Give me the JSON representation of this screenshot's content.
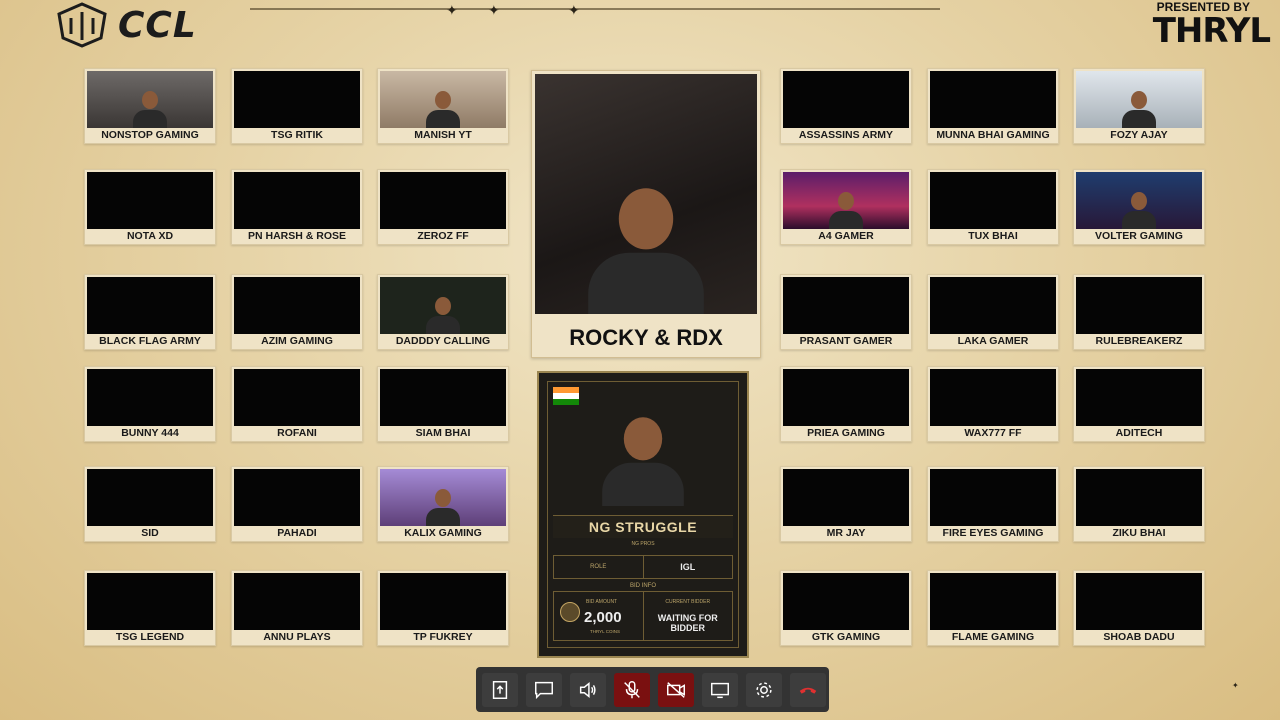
{
  "branding": {
    "logo_text": "CCL",
    "sponsor_label": "PRESENTED BY",
    "sponsor_name": "THRYL"
  },
  "featured": {
    "name": "ROCKY & RDX"
  },
  "participants": [
    {
      "name": "NONSTOP GAMING",
      "feed": "lit"
    },
    {
      "name": "TSG RITIK",
      "feed": "dark"
    },
    {
      "name": "MANISH YT",
      "feed": "room"
    },
    {
      "name": "ASSASSINS ARMY",
      "feed": "dark"
    },
    {
      "name": "MUNNA BHAI GAMING",
      "feed": "dark"
    },
    {
      "name": "FOZY AJAY",
      "feed": "bright"
    },
    {
      "name": "NOTA XD",
      "feed": "dark"
    },
    {
      "name": "PN HARSH & ROSE",
      "feed": "dark"
    },
    {
      "name": "ZEROZ FF",
      "feed": "dark"
    },
    {
      "name": "A4 GAMER",
      "feed": "neon"
    },
    {
      "name": "TUX BHAI",
      "feed": "dark"
    },
    {
      "name": "VOLTER GAMING",
      "feed": "blue"
    },
    {
      "name": "BLACK FLAG ARMY",
      "feed": "dark"
    },
    {
      "name": "AZIM GAMING",
      "feed": "dark"
    },
    {
      "name": "DADDDY CALLING",
      "feed": "green"
    },
    {
      "name": "PRASANT GAMER",
      "feed": "dark"
    },
    {
      "name": "LAKA GAMER",
      "feed": "dark"
    },
    {
      "name": "RULEBREAKERZ",
      "feed": "dark"
    },
    {
      "name": "BUNNY 444",
      "feed": "dark"
    },
    {
      "name": "ROFANI",
      "feed": "dark"
    },
    {
      "name": "SIAM BHAI",
      "feed": "dark"
    },
    {
      "name": "PRIEA GAMING",
      "feed": "dark"
    },
    {
      "name": "WAX777 FF",
      "feed": "dark"
    },
    {
      "name": "ADITECH",
      "feed": "dark"
    },
    {
      "name": "SID",
      "feed": "dark"
    },
    {
      "name": "PAHADI",
      "feed": "dark"
    },
    {
      "name": "KALIX GAMING",
      "feed": "purple"
    },
    {
      "name": "MR JAY",
      "feed": "dark"
    },
    {
      "name": "FIRE EYES GAMING",
      "feed": "dark"
    },
    {
      "name": "ZIKU BHAI",
      "feed": "dark"
    },
    {
      "name": "TSG LEGEND",
      "feed": "dark"
    },
    {
      "name": "ANNU PLAYS",
      "feed": "dark"
    },
    {
      "name": "TP FUKREY",
      "feed": "dark"
    },
    {
      "name": "GTK GAMING",
      "feed": "dark"
    },
    {
      "name": "FLAME GAMING",
      "feed": "dark"
    },
    {
      "name": "SHOAB DADU",
      "feed": "dark"
    }
  ],
  "player_card": {
    "country": "India",
    "name": "NG STRUGGLE",
    "team": "NG PROS",
    "role_label": "ROLE",
    "role_value": "IGL",
    "bid_info_label": "BID INFO",
    "bid_amount_label": "BID AMOUNT",
    "bid_amount": "2,000",
    "currency": "THRYL COINS",
    "current_bidder_label": "CURRENT BIDDER",
    "current_bidder": "WAITING FOR BIDDER"
  },
  "toolbar": {
    "buttons": [
      {
        "name": "share-button",
        "icon": "upload-icon",
        "style": "normal"
      },
      {
        "name": "chat-button",
        "icon": "chat-icon",
        "style": "normal"
      },
      {
        "name": "speaker-button",
        "icon": "speaker-icon",
        "style": "normal"
      },
      {
        "name": "mic-button",
        "icon": "mic-off-icon",
        "style": "red"
      },
      {
        "name": "camera-button",
        "icon": "camera-off-icon",
        "style": "red"
      },
      {
        "name": "screen-share-button",
        "icon": "monitor-icon",
        "style": "normal"
      },
      {
        "name": "settings-button",
        "icon": "gear-icon",
        "style": "normal"
      },
      {
        "name": "end-call-button",
        "icon": "hangup-icon",
        "style": "normal"
      }
    ]
  },
  "colors": {
    "accent_gold": "#c4a563",
    "toolbar_bg": "#333333",
    "danger": "#7a1010",
    "hangup": "#e03030"
  }
}
